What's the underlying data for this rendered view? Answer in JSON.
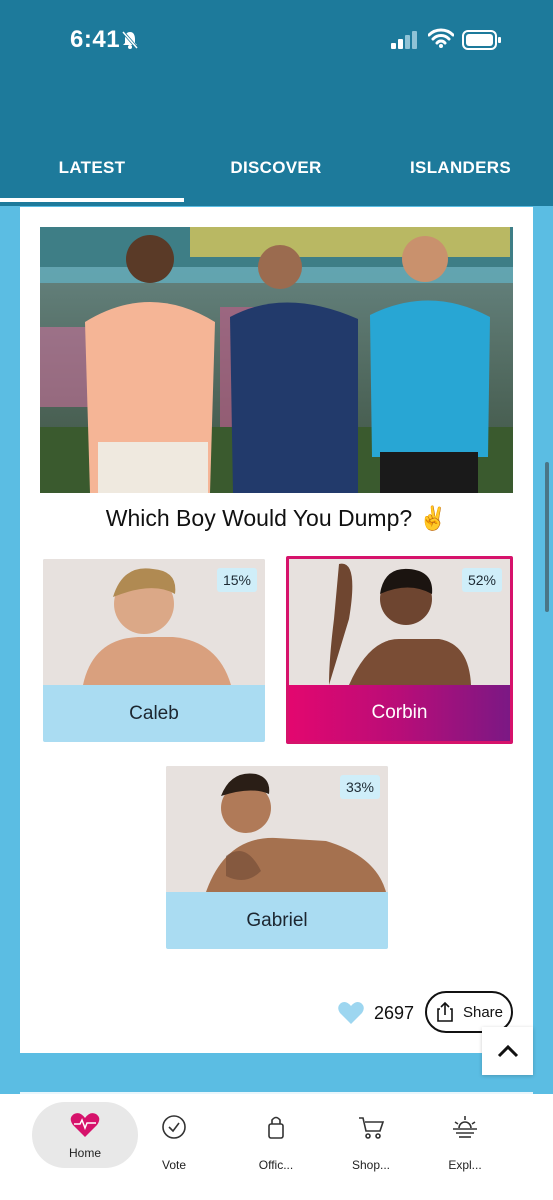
{
  "status_bar": {
    "time": "6:41"
  },
  "tabs": [
    {
      "label": "LATEST"
    },
    {
      "label": "DISCOVER"
    },
    {
      "label": "ISLANDERS"
    }
  ],
  "poll": {
    "title": "Which Boy Would You Dump? ✌️",
    "options": [
      {
        "name": "Caleb",
        "percent": "15%"
      },
      {
        "name": "Corbin",
        "percent": "52%"
      },
      {
        "name": "Gabriel",
        "percent": "33%"
      }
    ],
    "likes": "2697",
    "share_label": "Share"
  },
  "bottom_nav": {
    "items": [
      {
        "label": "Home"
      },
      {
        "label": "Vote"
      },
      {
        "label": "Offic..."
      },
      {
        "label": "Shop..."
      },
      {
        "label": "Expl..."
      }
    ]
  },
  "colors": {
    "header": "#1d7a9b",
    "background": "#5bbde3",
    "option_bg": "#aadcf2",
    "selected_start": "#e3076f",
    "selected_end": "#7b1884",
    "heart": "#9dd6f0"
  }
}
